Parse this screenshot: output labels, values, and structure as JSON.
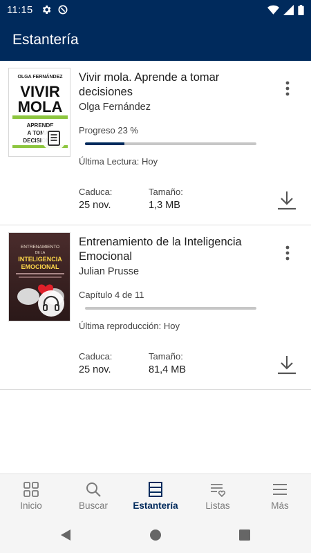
{
  "status_bar": {
    "time": "11:15"
  },
  "app_bar": {
    "title": "Estantería"
  },
  "books": [
    {
      "title": "Vivir mola. Aprende a tomar decisiones",
      "author": "Olga Fernández",
      "progress_text": "Progreso 23 %",
      "progress_fraction": 0.23,
      "last_text": "Última Lectura: Hoy",
      "expires_label": "Caduca:",
      "expires_value": "25 nov.",
      "size_label": "Tamaño:",
      "size_value": "1,3 MB",
      "format_icon": "ebook-icon",
      "cover": {
        "author": "OLGA FERNÁNDEZ",
        "line1": "VIVIR",
        "line2": "MOLA",
        "sub1": "APRENDE",
        "sub2": "A TOMAR",
        "sub3": "DECISIONES"
      }
    },
    {
      "title": "Entrenamiento de la Inteligencia Emocional",
      "author": "Julian Prusse",
      "progress_text": "Capítulo 4 de 11",
      "progress_fraction": 0.0,
      "last_text": "Última reproducción: Hoy",
      "expires_label": "Caduca:",
      "expires_value": "25 nov.",
      "size_label": "Tamaño:",
      "size_value": "81,4 MB",
      "format_icon": "headphones-icon",
      "cover": {
        "line1": "ENTRENAMIENTO",
        "line2": "DE LA",
        "line3": "INTELIGENCIA",
        "line4": "EMOCIONAL"
      }
    }
  ],
  "bottom_nav": [
    {
      "label": "Inicio",
      "icon": "grid-icon",
      "active": false
    },
    {
      "label": "Buscar",
      "icon": "search-icon",
      "active": false
    },
    {
      "label": "Estantería",
      "icon": "shelf-icon",
      "active": true
    },
    {
      "label": "Listas",
      "icon": "list-heart-icon",
      "active": false
    },
    {
      "label": "Más",
      "icon": "menu-icon",
      "active": false
    }
  ],
  "colors": {
    "primary": "#002a5c",
    "progress_track": "#c6c6c6",
    "nav_inactive": "#7a7a7a"
  }
}
